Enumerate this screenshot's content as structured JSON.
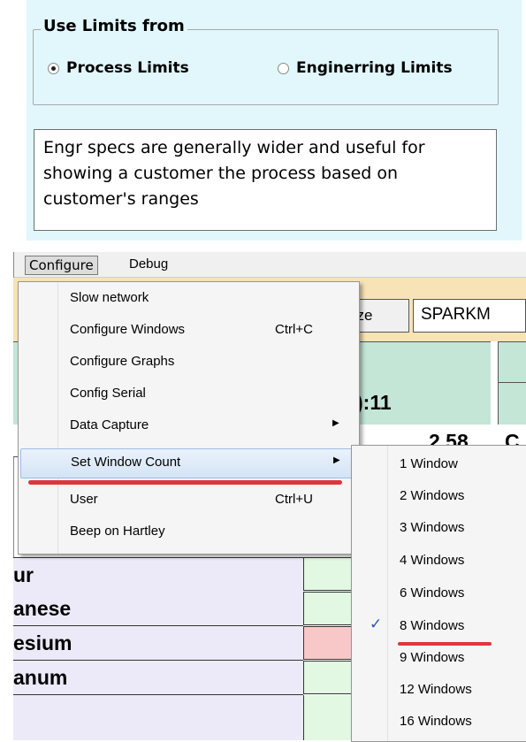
{
  "limits": {
    "group_title": "Use Limits from",
    "option_process": "Process Limits",
    "option_engineering": "Enginerring Limits",
    "selected": "process",
    "note": "Engr specs are generally wider and useful for showing a customer the process  based on customer's ranges"
  },
  "menubar": {
    "configure": "Configure",
    "debug": "Debug"
  },
  "background": {
    "freeze_fragment": "eze",
    "sparkm_fragment": "SPARKM",
    "time_fragment": "):11",
    "value_fragment": "2.58",
    "c_fragment": "C",
    "element_rows": [
      "ur",
      "anese",
      "esium",
      "anum"
    ]
  },
  "configure_menu": {
    "items": [
      {
        "label": "Slow network",
        "shortcut": "",
        "submenu": false
      },
      {
        "label": "Configure Windows",
        "shortcut": "Ctrl+C",
        "submenu": false
      },
      {
        "label": "Configure Graphs",
        "shortcut": "",
        "submenu": false
      },
      {
        "label": "Config Serial",
        "shortcut": "",
        "submenu": false
      },
      {
        "label": "Data Capture",
        "shortcut": "",
        "submenu": true
      },
      {
        "label": "Set Window Count",
        "shortcut": "",
        "submenu": true
      },
      {
        "label": "User",
        "shortcut": "Ctrl+U",
        "submenu": false
      },
      {
        "label": "Beep on Hartley",
        "shortcut": "",
        "submenu": false
      }
    ]
  },
  "window_count_submenu": {
    "items": [
      {
        "label": "1 Window",
        "checked": false
      },
      {
        "label": "2 Windows",
        "checked": false
      },
      {
        "label": "3 Windows",
        "checked": false
      },
      {
        "label": "4 Windows",
        "checked": false
      },
      {
        "label": "6 Windows",
        "checked": false
      },
      {
        "label": "8 Windows",
        "checked": true
      },
      {
        "label": "9 Windows",
        "checked": false
      },
      {
        "label": "12 Windows",
        "checked": false
      },
      {
        "label": "16 Windows",
        "checked": false
      }
    ]
  },
  "colors": {
    "panel_bg": "#e1f7fb",
    "annotation_red": "#e0363a",
    "cell_green": "#e2f8e2",
    "cell_pink": "#f8c8c8",
    "row_lavender": "#eceaf8",
    "header_teal": "#c3e6d6"
  }
}
